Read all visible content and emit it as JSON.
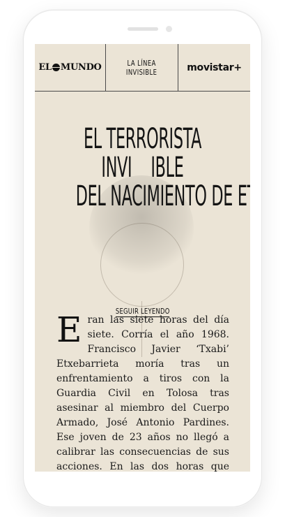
{
  "header": {
    "left_logo": "EL MUNDO",
    "left_logo_part1": "EL",
    "left_logo_part2": "MUNDO",
    "center_line1": "LA LÍNEA",
    "center_line2": "INVISIBLE",
    "right_logo": "movistar+"
  },
  "hero": {
    "title_line1": "EL TERRORISTA",
    "title_line2": "INVI    IBLE",
    "title_line3": "DEL NACIMIENTO DE ETA",
    "cta_label": "SEGUIR LEYENDO"
  },
  "article": {
    "dropcap": "E",
    "text": "ran las siete horas del día siete. Corría el año 1968. Francisco Javier ‘Txabi’ Etxebarrieta moría tras un enfrentamiento a tiros con la Guardia Civil en Tolosa tras asesinar al miembro del Cuerpo Armado, José Antonio Pardines. Ese joven de 23 años no llegó a calibrar las consecuencias de sus acciones. En las dos horas que transcurrieron entre la muerte de Pardines y la suya, se hundió en un"
  }
}
